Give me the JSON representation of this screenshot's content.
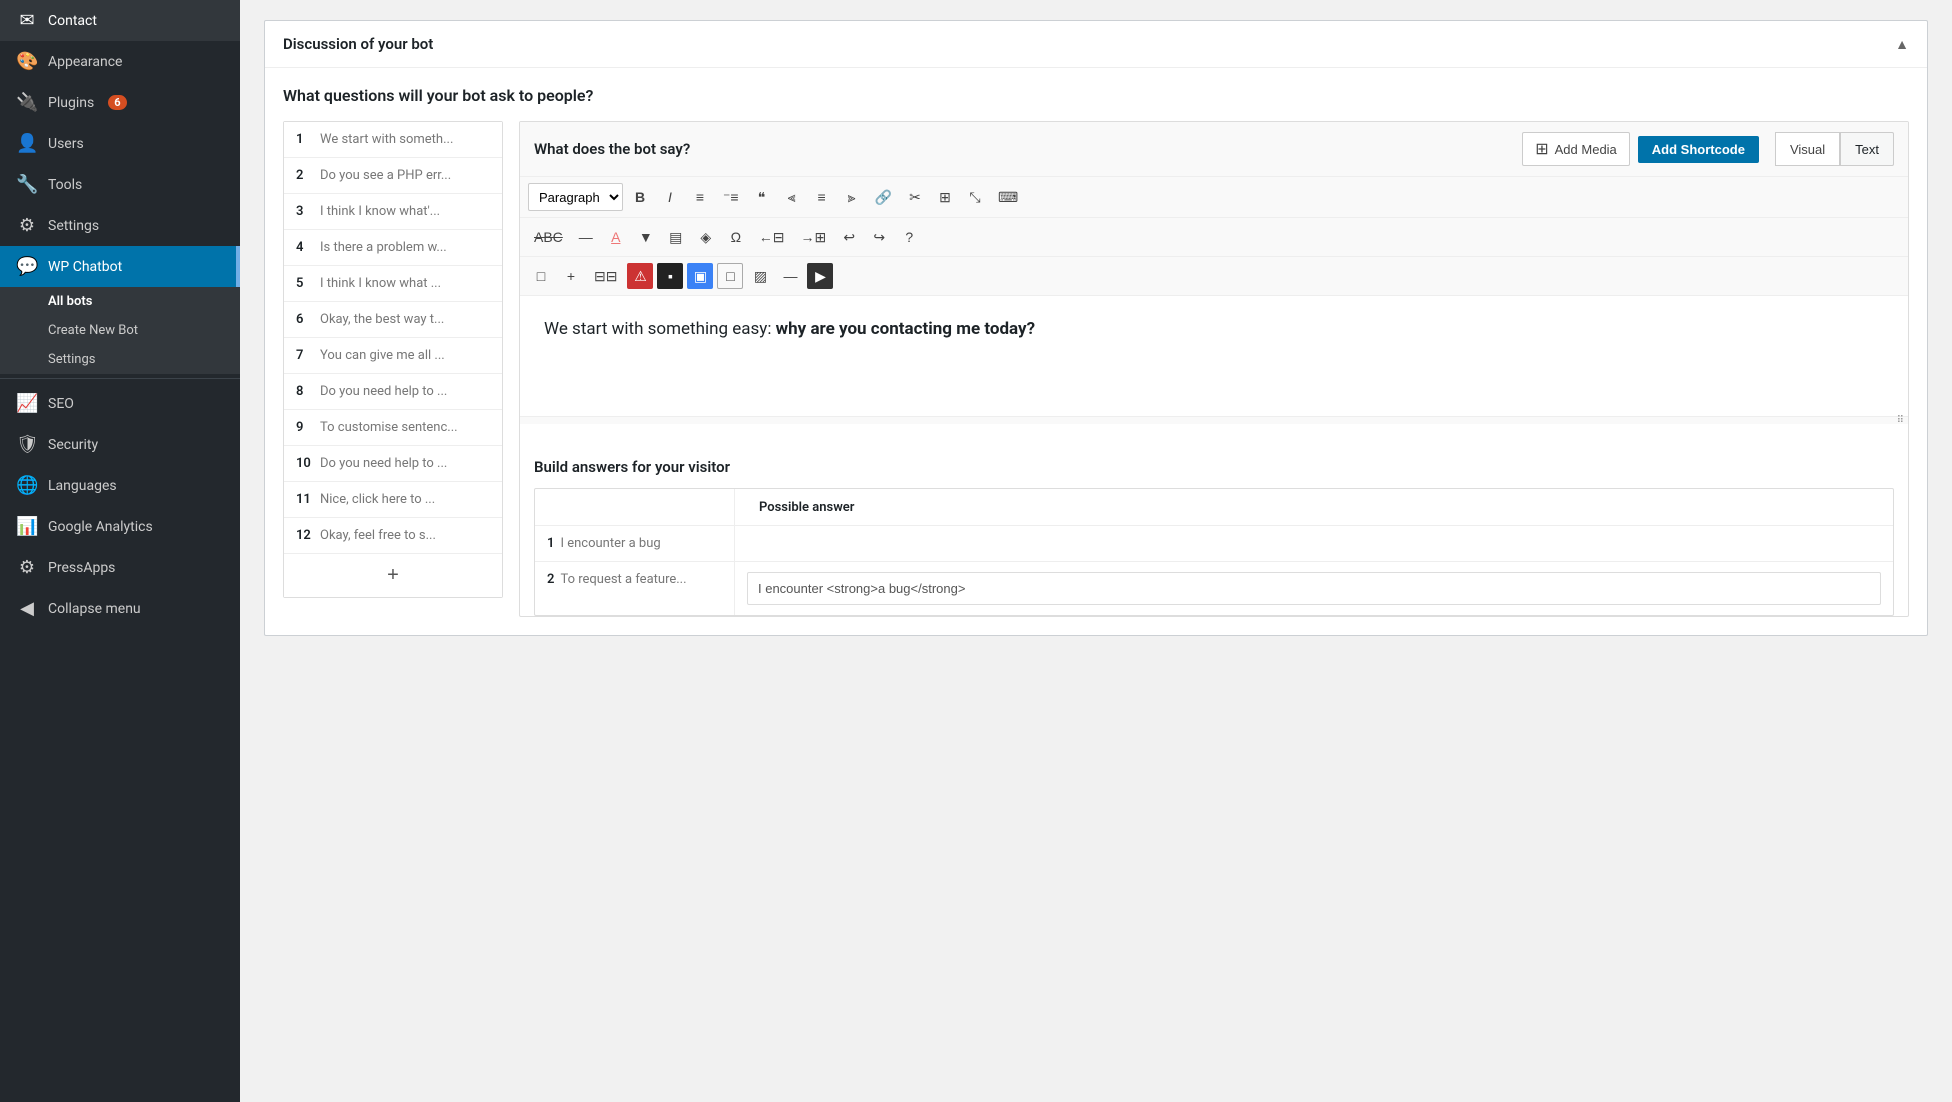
{
  "sidebar": {
    "items": [
      {
        "id": "contact",
        "label": "Contact",
        "icon": "✉",
        "active": false
      },
      {
        "id": "appearance",
        "label": "Appearance",
        "icon": "🎨",
        "active": false
      },
      {
        "id": "plugins",
        "label": "Plugins",
        "icon": "🔌",
        "active": false,
        "badge": "6"
      },
      {
        "id": "users",
        "label": "Users",
        "icon": "👤",
        "active": false
      },
      {
        "id": "tools",
        "label": "Tools",
        "icon": "🔧",
        "active": false
      },
      {
        "id": "settings",
        "label": "Settings",
        "icon": "⚙",
        "active": false
      },
      {
        "id": "wp-chatbot",
        "label": "WP Chatbot",
        "icon": "💬",
        "active": true
      }
    ],
    "wp_chatbot_sub": [
      {
        "id": "all-bots",
        "label": "All bots",
        "active": true
      },
      {
        "id": "create-new-bot",
        "label": "Create New Bot",
        "active": false
      },
      {
        "id": "settings",
        "label": "Settings",
        "active": false
      }
    ],
    "bottom_items": [
      {
        "id": "seo",
        "label": "SEO",
        "icon": "📈"
      },
      {
        "id": "security",
        "label": "Security",
        "icon": "🛡"
      },
      {
        "id": "languages",
        "label": "Languages",
        "icon": "🌐"
      },
      {
        "id": "google-analytics",
        "label": "Google Analytics",
        "icon": "📊"
      },
      {
        "id": "pressapps",
        "label": "PressApps",
        "icon": "⚙"
      },
      {
        "id": "collapse-menu",
        "label": "Collapse menu",
        "icon": "◀"
      }
    ]
  },
  "panel": {
    "title": "Discussion of your bot",
    "section_question": "What questions will your bot ask to people?",
    "editor_title": "What does the bot say?",
    "add_media_label": "Add Media",
    "add_shortcode_label": "Add Shortcode",
    "view_tabs": [
      {
        "id": "visual",
        "label": "Visual",
        "active": false
      },
      {
        "id": "text",
        "label": "Text",
        "active": true
      }
    ],
    "editor_content": "We start with something easy: why are you contacting me today?",
    "editor_content_bold_part": "why are you contacting me today?",
    "toolbar_row1": {
      "paragraph_select": "Paragraph",
      "buttons": [
        "B",
        "I",
        "≡",
        "⁻≡",
        "❝",
        "≡",
        "≡",
        "≡",
        "🔗",
        "✂",
        "≡",
        "⤡",
        "⌨"
      ]
    },
    "toolbar_row2": {
      "buttons": [
        "ABC̶",
        "—",
        "A",
        "▼",
        "▤",
        "◈",
        "Ω",
        "→",
        "←",
        "↩",
        "↪",
        "?"
      ]
    },
    "toolbar_row3": {
      "buttons": [
        "□",
        "+",
        "≡",
        "⚠",
        "▪",
        "▣",
        "□",
        "▨",
        "—",
        "▶"
      ]
    },
    "answers_section_title": "Build answers for your visitor",
    "answers_table": {
      "rows": [
        {
          "num": "1",
          "text": "I encounter a bug",
          "answer": ""
        },
        {
          "num": "2",
          "text": "To request a feature...",
          "answer": "I encounter <strong>a bug</strong>"
        }
      ],
      "possible_answer_label": "Possible answer"
    },
    "questions": [
      {
        "num": "1",
        "text": "We start with someth..."
      },
      {
        "num": "2",
        "text": "Do you see a PHP err..."
      },
      {
        "num": "3",
        "text": "I think I know what'..."
      },
      {
        "num": "4",
        "text": "Is there a problem w..."
      },
      {
        "num": "5",
        "text": "I think I know what ..."
      },
      {
        "num": "6",
        "text": "Okay, the best way t..."
      },
      {
        "num": "7",
        "text": "You can give me all ..."
      },
      {
        "num": "8",
        "text": "Do you need help to ..."
      },
      {
        "num": "9",
        "text": "To customise sentenc..."
      },
      {
        "num": "10",
        "text": "Do you need help to ..."
      },
      {
        "num": "11",
        "text": "Nice, click here to ..."
      },
      {
        "num": "12",
        "text": "Okay, feel free to s..."
      }
    ]
  }
}
